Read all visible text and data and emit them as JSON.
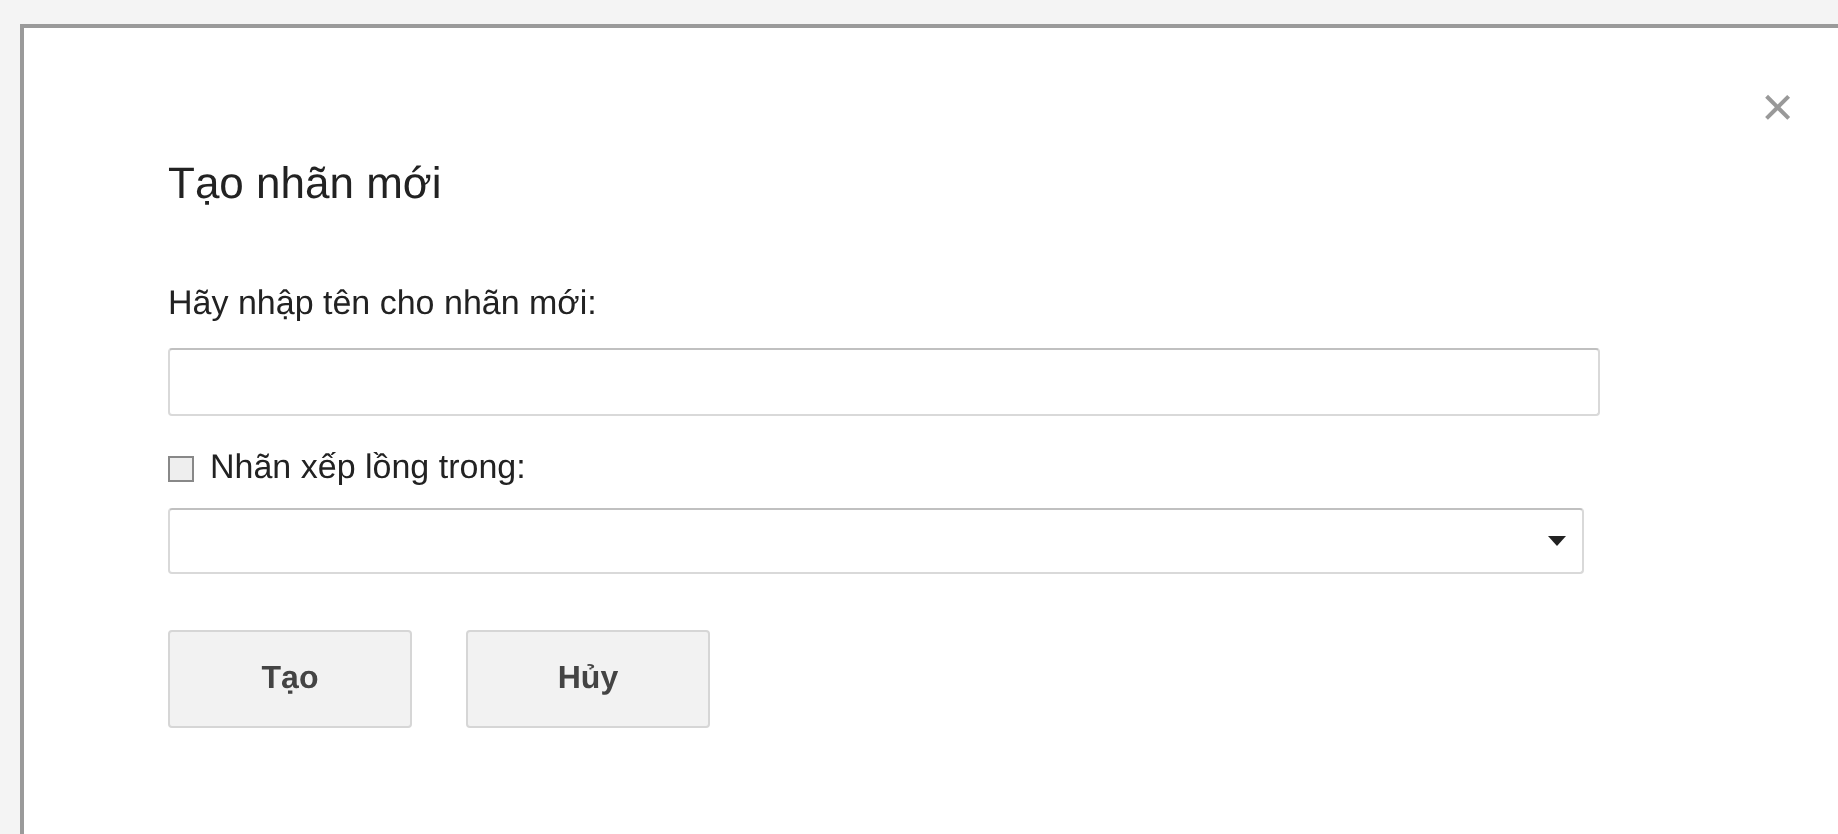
{
  "dialog": {
    "title": "Tạo nhãn mới",
    "close": "×",
    "name_field": {
      "label": "Hãy nhập tên cho nhãn mới:"
    },
    "nest": {
      "label": "Nhãn xếp lồng trong:",
      "checked": false
    },
    "buttons": [
      "Tạo",
      "Hủy"
    ]
  }
}
